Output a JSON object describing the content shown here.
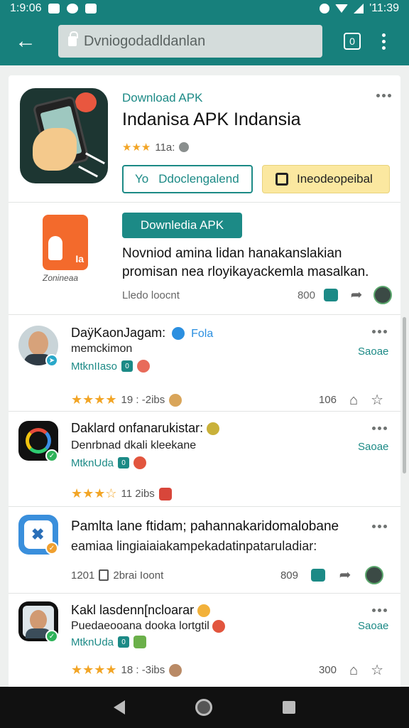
{
  "status_bar": {
    "time_left": "1:9:06",
    "time_right": "'11:39"
  },
  "browser": {
    "url": "Dvniogodadldanlan",
    "tabs_count": "0"
  },
  "app_header": {
    "label": "Download APK",
    "title": "Indanisa APK Indansia",
    "rating_text": "11a:",
    "btn_outline_icon": "Yo",
    "btn_outline": "Ddoclengalend",
    "btn_yellow": "Ineodeopeibal"
  },
  "promo": {
    "caption": "Zonineaa",
    "icon_text": "Ia",
    "button": "Downledia APK",
    "description": "Novniod amina lidan hanakanslakian promisan nea rloyikayackemla masalkan.",
    "meta_left": "Lledo loocnt",
    "meta_count": "800"
  },
  "feed": [
    {
      "title": "DaÿKaonJagam:",
      "verified_label": "Fola",
      "subtitle": "memckimon",
      "tag": "MtknIIaso",
      "tag_box": "0",
      "see": "Saoae",
      "stars": "★★★★",
      "meta_left": "19 : -2ibs",
      "meta_count": "106"
    },
    {
      "title": "Daklard onfanarukistar:",
      "subtitle": "Denrbnad dkali kleekane",
      "tag": "MtknUda",
      "tag_box": "0",
      "see": "Saoae",
      "stars": "★★★☆",
      "meta_left": "11 2ibs"
    },
    {
      "title": "Pamlta lane ftidam; pahannakaridomalobane",
      "subtitle": "eamiaa lingiaiaiakampekadatinpataruladiar:",
      "meta_left": "1201",
      "meta_mid": "2brai Ioont",
      "meta_count": "809"
    },
    {
      "title": "Kakl lasdenn[ncloarar",
      "subtitle": "Puedaeooana dooka lortgtil",
      "tag": "MtknUda",
      "tag_box": "0",
      "see": "Saoae",
      "stars": "★★★★",
      "meta_left": "18 : -3ibs",
      "meta_count": "300"
    }
  ],
  "icons": {
    "back": "arrow-left-icon",
    "lock": "lock-icon",
    "tabs": "tabs-icon",
    "menu": "more-vert-icon"
  },
  "colors": {
    "accent": "#1c8a86",
    "star": "#f2a526",
    "yellow_btn": "#fbe8a0"
  }
}
